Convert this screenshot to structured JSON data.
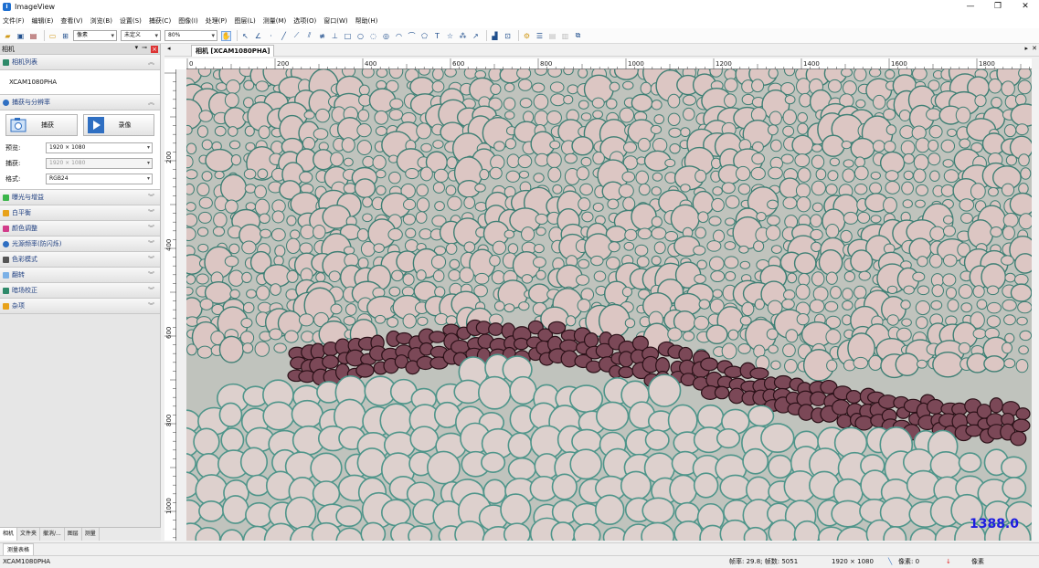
{
  "window": {
    "title": "ImageView",
    "controls": [
      "—",
      "❐",
      "✕"
    ]
  },
  "menu": [
    "文件(F)",
    "编辑(E)",
    "查看(V)",
    "浏览(B)",
    "设置(S)",
    "捕获(C)",
    "图像(I)",
    "处理(P)",
    "图层(L)",
    "测量(M)",
    "选项(O)",
    "窗口(W)",
    "帮助(H)"
  ],
  "toolbar": {
    "unit": "像素",
    "calib": "未定义",
    "zoom": "80%"
  },
  "panel": {
    "title": "相机",
    "camera_list": {
      "label": "相机列表",
      "device": "XCAM1080PHA"
    },
    "capture": {
      "label": "捕获与分辨率",
      "snap": "捕获",
      "record": "录像",
      "resolution_label": "预览:",
      "resolution": "1920 × 1080",
      "snap_res_label": "捕获:",
      "snap_res": "1920 × 1080",
      "format_label": "格式:",
      "format": "RGB24"
    },
    "sections": [
      "曝光与增益",
      "白平衡",
      "颜色调整",
      "光源频率(防闪烁)",
      "色彩模式",
      "翻转",
      "暗场校正",
      "杂项"
    ],
    "bottom_tabs": [
      "相机",
      "文件夹",
      "撤消/...",
      "图层",
      "测量"
    ]
  },
  "document": {
    "tab": "相机 [XCAM1080PHA]",
    "zoom_readout": "1388.0"
  },
  "ruler": {
    "h_labels": [
      "0",
      "200",
      "400",
      "600",
      "800",
      "1000",
      "1200",
      "1400",
      "1600",
      "1800"
    ],
    "v_labels": [
      "200",
      "400",
      "600",
      "800",
      "1000"
    ]
  },
  "bottom_tab": "测量表格",
  "status": {
    "device": "XCAM1080PHA",
    "fps": "帧率: 29.8; 帧数: 5051",
    "size": "1920 × 1080",
    "measure": "像素: 0",
    "unit": "像素"
  },
  "colors": {
    "accent": "#1f3f80",
    "zoom_text": "#1d1de0",
    "cell_wall": "#6b2c3a",
    "stain_green": "#5f9e96"
  }
}
